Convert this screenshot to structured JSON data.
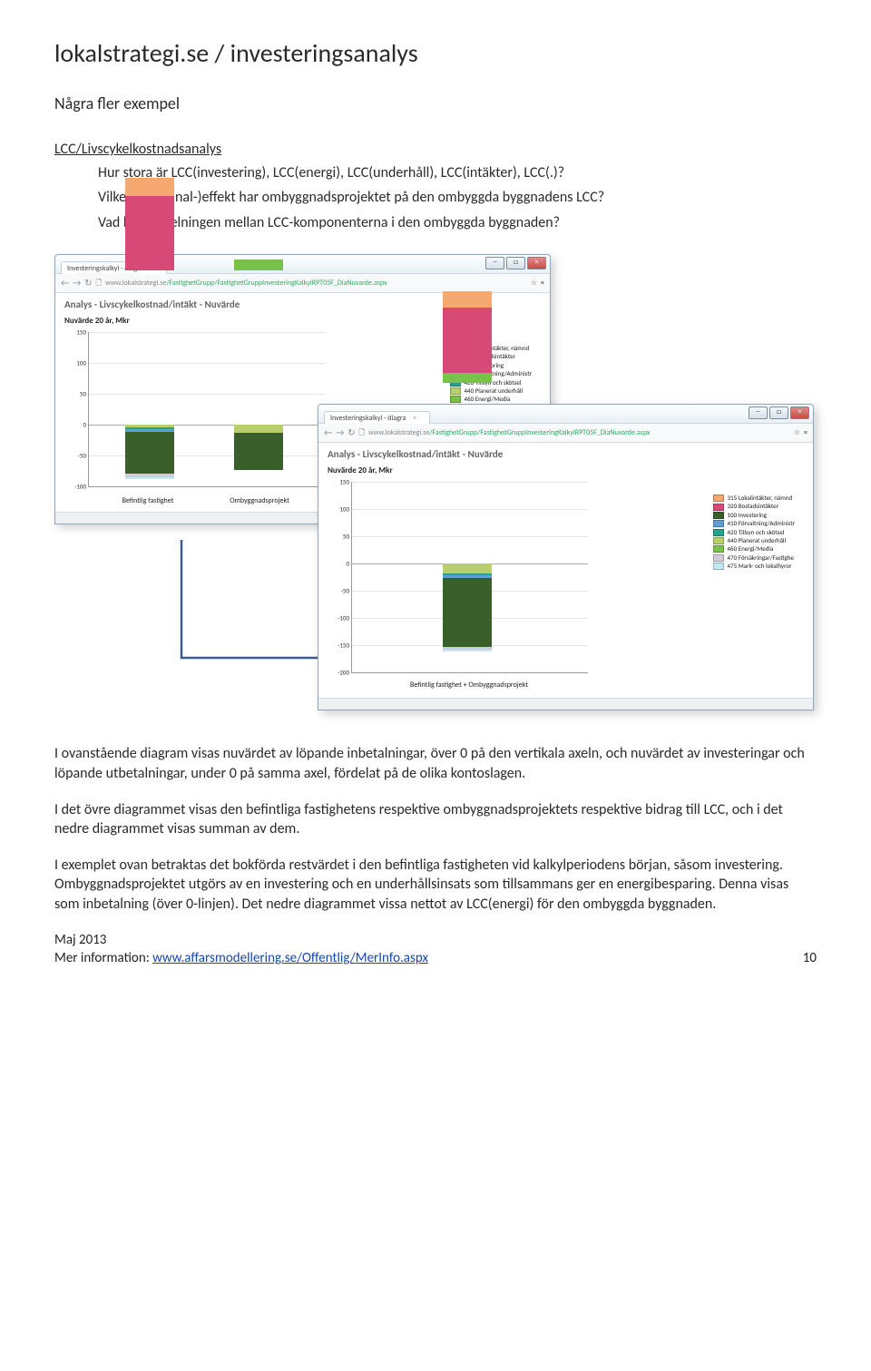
{
  "title": "lokalstrategi.se / investeringsanalys",
  "subtitle": "Några fler exempel",
  "section_heading": "LCC/Livscykelkostnadsanalys",
  "intro": {
    "q1": "Hur stora är LCC(investering), LCC(energi), LCC(underhåll), LCC(intäkter), LCC(.)?",
    "q2": "Vilken (marginal-)effekt har ombyggnadsprojektet på den ombyggda byggnadens LCC?",
    "q3": "Vad blir fördelningen mellan LCC-komponenterna i den ombyggda byggnaden?"
  },
  "browser": {
    "tab_label": "Investeringskalkyl - diagra",
    "url_host": "www.lokalstrategi.se",
    "url_path": "/FastighetGrupp/FastighetGruppInvesteringKalkylRPT05F_DiaNuvarde.aspx",
    "report_title": "Analys - Livscykelkostnad/intäkt - Nuvärde",
    "report_sub": "Nuvärde 20 år, Mkr"
  },
  "legend": [
    {
      "color": "#f5a971",
      "label": "315 Lokalintäkter, nämnd"
    },
    {
      "color": "#d74a78",
      "label": "320 Bostadsintäkter"
    },
    {
      "color": "#3a5f2a",
      "label": "100 Investering"
    },
    {
      "color": "#5f9fd4",
      "label": "410 Förvaltning/Administr"
    },
    {
      "color": "#26a28b",
      "label": "420 Tillsyn och skötsel"
    },
    {
      "color": "#b9cf6e",
      "label": "440 Planerat underhåll"
    },
    {
      "color": "#78c24c",
      "label": "460 Energi/Media"
    },
    {
      "color": "#d1ccd9",
      "label": "470 Försäkringar/Fastighe"
    },
    {
      "color": "#bfeaf2",
      "label": "475 Mark- och lokalhyror"
    }
  ],
  "chart_data": [
    {
      "type": "bar",
      "title": "Analys - Livscykelkostnad/intäkt - Nuvärde",
      "subtitle": "Nuvärde 20 år, Mkr",
      "ylabel": "Mkr",
      "ylim": [
        -100,
        150
      ],
      "yticks": [
        150,
        100,
        50,
        0,
        -50,
        -100
      ],
      "categories": [
        "Befintlig fastighet",
        "Ombyggnadsprojekt"
      ],
      "series": [
        {
          "name": "315 Lokalintäkter, nämnd",
          "values": [
            30,
            0
          ]
        },
        {
          "name": "320 Bostadsintäkter",
          "values": [
            120,
            0
          ]
        },
        {
          "name": "460 Energi/Media",
          "values": [
            0,
            18
          ]
        },
        {
          "name": "440 Planerat underhåll",
          "values": [
            -4,
            -14
          ]
        },
        {
          "name": "420 Tillsyn och skötsel",
          "values": [
            -4,
            0
          ]
        },
        {
          "name": "410 Förvaltning/Administr",
          "values": [
            -4,
            0
          ]
        },
        {
          "name": "100 Investering",
          "values": [
            -68,
            -60
          ]
        },
        {
          "name": "470 Försäkringar/Fastighe",
          "values": [
            -5,
            0
          ]
        },
        {
          "name": "475 Mark- och lokalhyror",
          "values": [
            -3,
            0
          ]
        }
      ]
    },
    {
      "type": "bar",
      "title": "Analys - Livscykelkostnad/intäkt - Nuvärde",
      "subtitle": "Nuvärde 20 år, Mkr",
      "ylabel": "Mkr",
      "ylim": [
        -200,
        150
      ],
      "yticks": [
        150,
        100,
        50,
        0,
        -50,
        -100,
        -150,
        -200
      ],
      "categories": [
        "Befintlig fastighet + Ombyggnadsprojekt"
      ],
      "series": [
        {
          "name": "315 Lokalintäkter, nämnd",
          "values": [
            30
          ]
        },
        {
          "name": "320 Bostadsintäkter",
          "values": [
            120
          ]
        },
        {
          "name": "460 Energi/Media",
          "values": [
            18
          ]
        },
        {
          "name": "440 Planerat underhåll",
          "values": [
            -18
          ]
        },
        {
          "name": "420 Tillsyn och skötsel",
          "values": [
            -4
          ]
        },
        {
          "name": "410 Förvaltning/Administr",
          "values": [
            -4
          ]
        },
        {
          "name": "100 Investering",
          "values": [
            -128
          ]
        },
        {
          "name": "470 Försäkringar/Fastighe",
          "values": [
            -5
          ]
        },
        {
          "name": "475 Mark- och lokalhyror",
          "values": [
            -3
          ]
        }
      ]
    }
  ],
  "body": {
    "p1": "I ovanstående diagram visas nuvärdet av löpande inbetalningar, över 0 på den vertikala axeln, och nuvärdet av investeringar och löpande utbetalningar, under 0 på samma axel, fördelat på de olika kontoslagen.",
    "p2": "I det övre diagrammet visas den befintliga fastighetens respektive ombyggnadsprojektets respektive bidrag till LCC, och i det nedre diagrammet visas summan av dem.",
    "p3": "I exemplet ovan betraktas det bokförda restvärdet i den befintliga fastigheten vid kalkylperiodens början, såsom investering. Ombyggnadsprojektet utgörs av en investering och en underhållsinsats som tillsammans ger en energibesparing. Denna visas som inbetalning (över 0-linjen). Det nedre diagrammet vissa nettot av LCC(energi) för den ombyggda byggnaden."
  },
  "footer": {
    "date": "Maj 2013",
    "more": "Mer information: ",
    "link": "www.affarsmodellering.se/Offentlig/MerInfo.aspx",
    "page": "10"
  }
}
